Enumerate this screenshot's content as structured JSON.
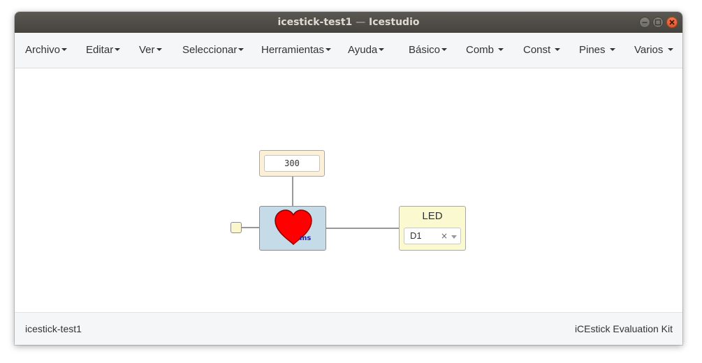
{
  "window": {
    "title_project": "icestick-test1",
    "title_separator": "—",
    "title_app": "Icestudio"
  },
  "menubar": {
    "items": [
      {
        "label": "Archivo"
      },
      {
        "label": "Editar"
      },
      {
        "label": "Ver"
      },
      {
        "label": "Seleccionar"
      },
      {
        "label": "Herramientas"
      },
      {
        "label": "Ayuda"
      },
      {
        "label": "Básico"
      },
      {
        "label": "Comb"
      },
      {
        "label": "Const"
      },
      {
        "label": "Pines"
      },
      {
        "label": "Varios"
      }
    ]
  },
  "canvas": {
    "constant_block": {
      "value": "300"
    },
    "heartbeat_block": {
      "icon": "heart-icon",
      "unit_label": "ms",
      "heart_color": "#ff0000"
    },
    "led_block": {
      "label": "LED",
      "pin_value": "D1",
      "clear_glyph": "×"
    }
  },
  "statusbar": {
    "project_name": "icestick-test1",
    "board_name": "iCEstick Evaluation Kit"
  },
  "colors": {
    "titlebar": "#4f4c47",
    "menubar": "#f5f6f7",
    "constant_block": "#fcf1d6",
    "heartbeat_block": "#c5dce8",
    "led_block": "#fbf9cf",
    "close_button": "#e9582e"
  }
}
